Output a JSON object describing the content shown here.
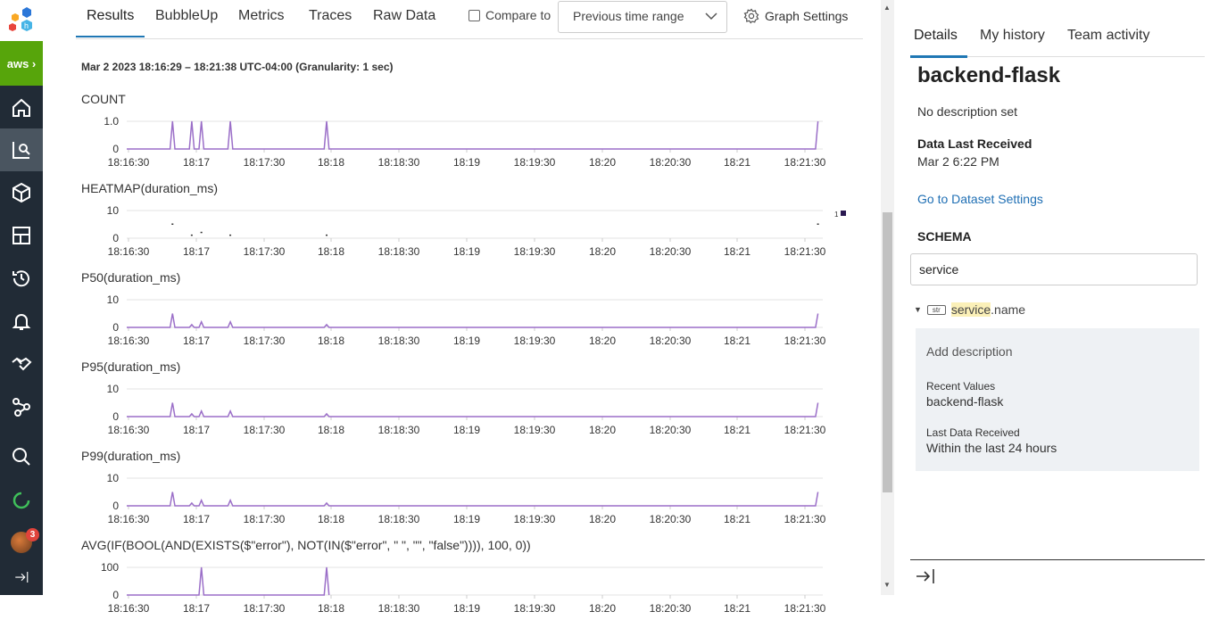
{
  "nav": {
    "aws_label": "aws",
    "icons": [
      "home-icon",
      "query-icon",
      "cube-icon",
      "boards-icon",
      "history-icon",
      "bell-icon",
      "handshake-icon",
      "service-map-icon",
      "search-icon",
      "loading-icon"
    ],
    "badge_count": "3"
  },
  "tabs": [
    {
      "label": "Results"
    },
    {
      "label": "BubbleUp"
    },
    {
      "label": "Metrics"
    },
    {
      "label": "Traces"
    },
    {
      "label": "Raw Data"
    }
  ],
  "toolbar": {
    "compare_label": "Compare to",
    "compare_select": "Previous time range",
    "graph_settings": "Graph Settings"
  },
  "results": {
    "date_range": "Mar 2 2023 18:16:29 – 18:21:38 UTC-04:00 (Granularity: 1 sec)",
    "x_ticks": [
      "18:16:30",
      "18:17",
      "18:17:30",
      "18:18",
      "18:18:30",
      "18:19",
      "18:19:30",
      "18:20",
      "18:20:30",
      "18:21",
      "18:21:30"
    ],
    "heatmap_legend": "1"
  },
  "chart_data": [
    {
      "type": "line",
      "title": "COUNT",
      "y_ticks": [
        "1.0",
        "0"
      ],
      "ylim": [
        0,
        1
      ],
      "series": [
        {
          "values": [
            [
              0,
              0
            ],
            [
              9,
              0
            ],
            [
              9.5,
              1
            ],
            [
              10,
              0
            ],
            [
              13,
              0
            ],
            [
              13.5,
              1
            ],
            [
              14,
              0
            ],
            [
              15,
              0
            ],
            [
              15.5,
              1
            ],
            [
              16,
              0
            ],
            [
              21,
              0
            ],
            [
              21.5,
              1
            ],
            [
              22,
              0
            ],
            [
              41,
              0
            ],
            [
              41.5,
              1
            ],
            [
              42,
              0
            ],
            [
              143,
              0
            ],
            [
              143.5,
              1
            ]
          ]
        }
      ]
    },
    {
      "type": "heatmap",
      "title": "HEATMAP(duration_ms)",
      "y_ticks": [
        "10",
        "0"
      ],
      "ylim": [
        0,
        10
      ],
      "points": [
        [
          9.5,
          5
        ],
        [
          13.5,
          1
        ],
        [
          15.5,
          2
        ],
        [
          21.5,
          1
        ],
        [
          41.5,
          1
        ],
        [
          143.5,
          5
        ]
      ]
    },
    {
      "type": "line",
      "title": "P50(duration_ms)",
      "y_ticks": [
        "10",
        "0"
      ],
      "ylim": [
        0,
        10
      ],
      "series": [
        {
          "values": [
            [
              0,
              0
            ],
            [
              9,
              0
            ],
            [
              9.5,
              5
            ],
            [
              10,
              0
            ],
            [
              13,
              0
            ],
            [
              13.5,
              1
            ],
            [
              14,
              0
            ],
            [
              15,
              0
            ],
            [
              15.5,
              2
            ],
            [
              16,
              0
            ],
            [
              21,
              0
            ],
            [
              21.5,
              2
            ],
            [
              22,
              0
            ],
            [
              41,
              0
            ],
            [
              41.5,
              1
            ],
            [
              42,
              0
            ],
            [
              143,
              0
            ],
            [
              143.5,
              5
            ]
          ]
        }
      ]
    },
    {
      "type": "line",
      "title": "P95(duration_ms)",
      "y_ticks": [
        "10",
        "0"
      ],
      "ylim": [
        0,
        10
      ],
      "series": [
        {
          "values": [
            [
              0,
              0
            ],
            [
              9,
              0
            ],
            [
              9.5,
              5
            ],
            [
              10,
              0
            ],
            [
              13,
              0
            ],
            [
              13.5,
              1
            ],
            [
              14,
              0
            ],
            [
              15,
              0
            ],
            [
              15.5,
              2
            ],
            [
              16,
              0
            ],
            [
              21,
              0
            ],
            [
              21.5,
              2
            ],
            [
              22,
              0
            ],
            [
              41,
              0
            ],
            [
              41.5,
              1
            ],
            [
              42,
              0
            ],
            [
              143,
              0
            ],
            [
              143.5,
              5
            ]
          ]
        }
      ]
    },
    {
      "type": "line",
      "title": "P99(duration_ms)",
      "y_ticks": [
        "10",
        "0"
      ],
      "ylim": [
        0,
        10
      ],
      "series": [
        {
          "values": [
            [
              0,
              0
            ],
            [
              9,
              0
            ],
            [
              9.5,
              5
            ],
            [
              10,
              0
            ],
            [
              13,
              0
            ],
            [
              13.5,
              1
            ],
            [
              14,
              0
            ],
            [
              15,
              0
            ],
            [
              15.5,
              2
            ],
            [
              16,
              0
            ],
            [
              21,
              0
            ],
            [
              21.5,
              2
            ],
            [
              22,
              0
            ],
            [
              41,
              0
            ],
            [
              41.5,
              1
            ],
            [
              42,
              0
            ],
            [
              143,
              0
            ],
            [
              143.5,
              5
            ]
          ]
        }
      ]
    },
    {
      "type": "line",
      "title": "AVG(IF(BOOL(AND(EXISTS($\"error\"), NOT(IN($\"error\", \" \", \"\", \"false\")))), 100, 0))",
      "y_ticks": [
        "100",
        "0"
      ],
      "ylim": [
        0,
        100
      ],
      "series": [
        {
          "values": [
            [
              0,
              0
            ],
            [
              15,
              0
            ],
            [
              15.5,
              100
            ],
            [
              16,
              0
            ],
            [
              41,
              0
            ],
            [
              41.5,
              100
            ],
            [
              42,
              0
            ]
          ]
        }
      ]
    }
  ],
  "details": {
    "tabs": [
      "Details",
      "My history",
      "Team activity"
    ],
    "dataset": "backend-flask",
    "description": "No description set",
    "last_received_label": "Data Last Received",
    "last_received": "Mar 2 6:22 PM",
    "settings_link": "Go to Dataset Settings",
    "schema_label": "SCHEMA",
    "search_value": "service",
    "field_type": "str",
    "field_highlight": "service",
    "field_rest": ".name",
    "add_description": "Add description",
    "recent_values_label": "Recent Values",
    "recent_values": "backend-flask",
    "last_data_label": "Last Data Received",
    "last_data": "Within the last 24 hours"
  },
  "colors": {
    "series": "#9b6fc8",
    "accent": "#1f77b4",
    "nav": "#212b36",
    "aws": "#57a50b"
  }
}
